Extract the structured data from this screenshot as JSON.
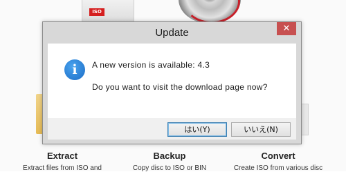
{
  "dialog": {
    "title": "Update",
    "close_glyph": "✕",
    "icon": "info-icon",
    "icon_glyph": "i",
    "message_line1": "A new version is available: 4.3",
    "message_line2": "Do you want to visit the download page now?",
    "buttons": {
      "yes_label": "はい(Y)",
      "no_label": "いいえ(N)"
    }
  },
  "background": {
    "doc_badge": "ISO",
    "features": [
      {
        "title": "Extract",
        "description": "Extract files from ISO and"
      },
      {
        "title": "Backup",
        "description": "Copy disc to ISO or BIN"
      },
      {
        "title": "Convert",
        "description": "Create ISO from various disc"
      }
    ]
  },
  "colors": {
    "close_button": "#c75050",
    "info_icon": "#1a6cc6",
    "default_button_border": "#3c7fb1"
  }
}
